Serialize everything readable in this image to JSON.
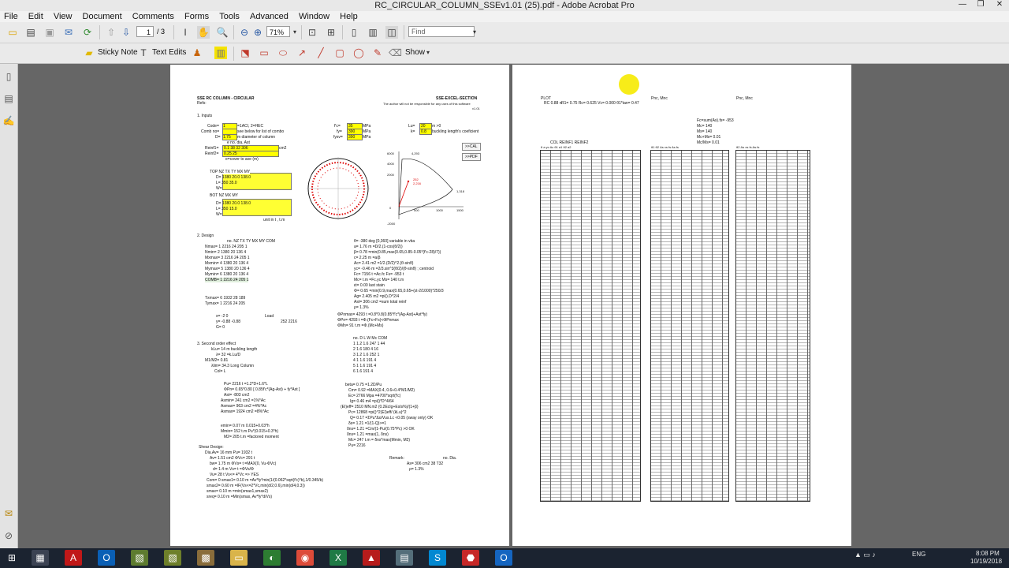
{
  "window": {
    "title": "RC_CIRCULAR_COLUMN_SSEv1.01 (25).pdf - Adobe Acrobat Pro",
    "min": "—",
    "max": "❐",
    "close": "✕"
  },
  "menu": [
    "File",
    "Edit",
    "View",
    "Document",
    "Comments",
    "Forms",
    "Tools",
    "Advanced",
    "Window",
    "Help"
  ],
  "toolbar": {
    "page_current": "1",
    "page_total": "/ 3",
    "zoom": "71%",
    "find_placeholder": "Find"
  },
  "toolbar2": {
    "sticky_note": "Sticky Note",
    "text_edits": "Text Edits",
    "show": "Show"
  },
  "doc": {
    "p1": {
      "title_left": "SSE RC COLUMN - CIRCULAR",
      "refs": "Refs:",
      "title_right": "SSE-EXCEL-SECTION",
      "disclaimer": "The author will not be responsible for any uses of this software",
      "version": "v1.01",
      "s1": "1. Inputs",
      "code_lbl": "Code=",
      "code_val": "1",
      "code_note": "=1ACI, 2=HEC",
      "combo_lbl": "Comb no=",
      "combo_note": "see below for list of combo",
      "d_lbl": "D=",
      "d_val": "1.75",
      "d_note": "m diameter of column",
      "reinf_hdr": "e   no.   dia.   Ast",
      "reinf1_lbl": "Reinf1=",
      "reinf1": "0.1    38    32    306",
      "reinf2_lbl": "Reinf2=",
      "reinf2": "0.25          25",
      "reinf_unit": "cm2",
      "cover": "e=cover to axe (m)",
      "fc_lbl": "f'c=",
      "fc_val": "35",
      "fc_unit": "MPa",
      "fy_lbl": "fy=",
      "fy_val": "390",
      "fy_unit": "MPa",
      "fysv_lbl": "fysv=",
      "fysv_val": "390",
      "fysv_unit": "MPa",
      "lu_lbl": "Lu=",
      "lu_val": "20",
      "lu_unit": "m >0",
      "k_lbl": "k=",
      "k_val": "0.8",
      "k_note": "buckling length's coeficient",
      "btn_cal": ">>CAL",
      "btn_pdf": ">>PDF",
      "top_hdr": "TOP    NZ    TX    TY    MX    MY",
      "top_d": "D=  1380   20.0         138.0",
      "top_l": "L=   350                  35.0",
      "top_w": "W=",
      "bot_hdr": "BOT    NZ    MX    MY",
      "bot_d": "D=  1380   20.0         138.0",
      "bot_l": "L=   350                  15.0",
      "bot_w": "W=",
      "unit_note": "unit in t , t.m",
      "chart_y": [
        "6000",
        "5000",
        "4000",
        "3000",
        "2000",
        "1000",
        "0",
        "-1000",
        "-2000"
      ],
      "chart_x": [
        "0",
        "500",
        "1000",
        "1500"
      ],
      "chart_pts": [
        "4,293",
        "2,216",
        "1,318"
      ],
      "chart_red": [
        "252",
        "2,216"
      ],
      "s2": "2. Design",
      "design_hdr": "no.   NZ   TX   TY   MX   MY   COM",
      "design_rows": [
        "Design:      ",
        "Nmax=  1   2216   24          205    1",
        "Nmin=  2   1380   20          136    4",
        "Mxmax= 3   2216   24          205    1",
        "Mxmin= 4   1380   20          136    4",
        "Mymax= 5   1380   20          136    4",
        "Mymin= 6   1380   20          136    4",
        "COMB=  1   2216   24          205    1"
      ],
      "txmax": "Txmax=   6   1932   28        189",
      "tymax": "Tymax=   1   2216   24        205",
      "x_row": "x=    -2       0",
      "y_row": "y=  -0.88   -0.88",
      "g_row": "G=               0",
      "load_lbl": "Load",
      "load_vals": "252   2216",
      "calc_right": [
        "θ=   -380  deg [0,360] variable in vba",
        "a=   1.76  m =D/2.(1-cos(θ/2))",
        "β=   0.78  =min(0.85,max(0.65,0.85-0.05*(f'c-28)/7))",
        "c=   2.25  m =a/β",
        "Ac=  2.41  m2 =1/2.(D/2)^2.(θ-sinθ)",
        "yc=  -0.46  m =2/3.sin^3(θ/2)/(θ-sinθ) ; centroid",
        "Fc=  7156  t =Ac.fc         Fs=  -953  t",
        "Mc=        t.m =Fc.yc       Ms=   140  t.m",
        "εt=  0.00  last stain",
        "Φ=   0.65  =min(0.9,max(0.65,0.65+(εt-2/1000)*250/3",
        "Ag=  2.405  m2 =pi().D^2/4",
        "Ast=  306  cm2 =sum total reinf",
        "ρ=   1.3%",
        "ΦPnmax=  4293  t =0.8*0.8(0.85*f'c*(Ag-Ast)+Ast*fy)",
        "ΦPn=     4293  t =Φ.(Fc+Fs)<ΦPnmax",
        "ΦMn=       91  t.m =Φ.(Mc+Ms)"
      ],
      "s3": "3. Second order effect",
      "kl_row": "kLu=    14  m buckling length",
      "r_row": "λ=     32  =k.Lu/D",
      "m1m2_row": "M1/M2=  0.81",
      "lim_row": "λlim=  34.3  Long Column",
      "col_row": "Col=     L",
      "loadtab_hdr": "no.    D     L     W     Mc   COM",
      "loadtab": [
        "1    1.2   1.6          247    1    44",
        "2                 1.6   180    4    16",
        "3    1.2   1.6          252    1",
        "4     1               1.6   191    4",
        "5     1               1.6   191    4",
        "6                 1.6   191    4"
      ],
      "pu_block": [
        "Pu=  2216  t =1.2*D+1.6*L",
        "ΦPn= 0.65*0.80 [ 0.85f'c*(Ag-Ast) + fy*Ast ]",
        "Ast=  -803  cm2",
        "Asmin=  241  cm2 =1%*Ac",
        "Asmax=  963  cm2 =4%*Ac",
        "Asmax= 1924  cm2 =8%*Ac",
        "",
        "emin=  0.07  m 0.015+0.03*h",
        "Mmin=   152  t.m Pu*(0.015+0.3*h)",
        "M2=     205  t.m =factored moment"
      ],
      "beta_block": [
        "beta=  0.75  =1.2D/Pu",
        "Cm=    0.92  =MAX(0.4, 0.6+0.4*M1/M2)",
        "Ec=    2766  Mpa =4700*sqrt(f'c)",
        "Ig=    0.46  m4 =pi()*D^4/64",
        "(EI)eff=  2510  MN.m2 (0.2EcIg+EsIs%)/(1+β)",
        "Pc=   12868  =pi()^2(EI)eff/ (kLu)^2",
        "Q=     0.17  =ΣPu*Δo/Vus.Lc <0.05 (sway only)   OK",
        "δs=    1.21  =1/(1-Q)>=1",
        "δns=   1.21  =Cm/(1-Pu/(0.75*Pc) >0      OK",
        "δns=   1.21  =max(1, δns)",
        "Mc=     247  t.m = δns*max(Mmin, M2)",
        "Pu=    2216"
      ],
      "shear_hdr": "Shear Design:",
      "shear": [
        "Dia.Av=   16  mm          Pu=  1932  t",
        "Av=    1.51  cm2          ΦVc=   291  t",
        "bw=    1.75  m            ΦVs=          t =MAX(0, Vu-ΦVc)",
        "d=      1.4  m             Vs=          t =ΦVs/Φ",
        "Vu=      28  t            Vs<=  4*Vc =>         YES",
        "Com=      0              smax1=  0.10  m =Av*fy*min(1/(0.062*sqrt(f'c)*b),1/0.345/b)",
        "                         smax2=  0.60  m =IF(Vs<=2*Vc,min(d/2,0.6),min(d/4,0.3))",
        "                         smax=   0.10  m =min(smax1,smax2)",
        "                         sreq=   0.10  m =Min(smax, Av*fy*d/Vs)"
      ],
      "remark_lbl": "Remark:",
      "remark_as": "As=   306  cm2    38   T32",
      "remark_rho": "ρ=    1.3%",
      "remark_hdr": "no.    Dia."
    },
    "p2": {
      "plot_hdr": "PLOT",
      "plot_rows": [
        "RC  0.88  n",
        "R1=  0.75  Rc=  0.625  Vc=  0.000  θ1*tan=  0.47"
      ],
      "pnc_mnc1": "Pnc, Mnc",
      "pnc_mnc2": "Pnc, Mnc",
      "col_hdr": "COL        REINF1            REINF2",
      "tab_hdr": "θ    a    yc    Ac    θ1    a1    θ2    a2",
      "mid_hdr": "θ1    θ2    As    xs    fs    As.fs",
      "right_hdr": "θ2    As    xs    fs    As.fs",
      "mc_block": [
        "Fc=sum(As).fs=  -953",
        "Mc=  140",
        "Ms=  140",
        "Mc+Ms=  0.01",
        "Mc/Ms=  0.01"
      ]
    }
  },
  "taskbar": {
    "time": "8:08 PM",
    "date": "10/19/2018",
    "lang": "ENG"
  }
}
